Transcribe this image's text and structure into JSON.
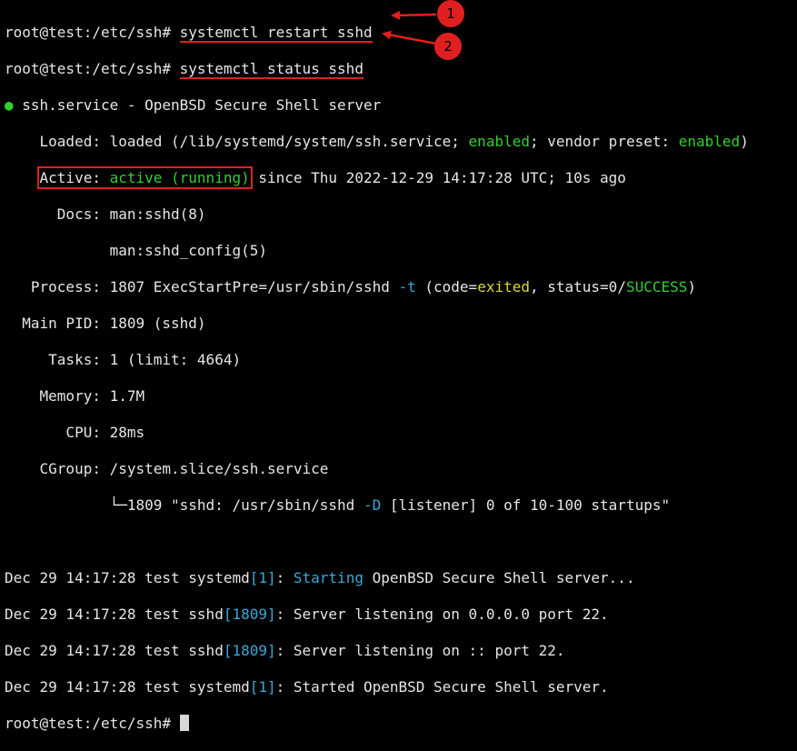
{
  "prompt": "root@test:/etc/ssh# ",
  "commands": [
    "systemctl restart sshd",
    "systemctl status sshd"
  ],
  "service": {
    "dot": "●",
    "header": " ssh.service - OpenBSD Secure Shell server",
    "loaded_label": "    Loaded: ",
    "loaded_a": "loaded (/lib/systemd/system/ssh.service; ",
    "loaded_enabled": "enabled",
    "loaded_b": "; vendor preset: ",
    "loaded_enabled2": "enabled",
    "loaded_c": ")",
    "active_indent": "    ",
    "active_label": "Active: ",
    "active_value": "active (running)",
    "active_rest": " since Thu 2022-12-29 14:17:28 UTC; 10s ago",
    "docs_1": "      Docs: man:sshd(8)",
    "docs_2": "            man:sshd_config(5)",
    "process_a": "   Process: 1807 ExecStartPre=/usr/sbin/sshd ",
    "process_flag": "-t",
    "process_b": " (code=",
    "process_exited": "exited",
    "process_c": ", status=0/",
    "process_success": "SUCCESS",
    "process_d": ")",
    "mainpid": "  Main PID: 1809 (sshd)",
    "tasks": "     Tasks: 1 (limit: 4664)",
    "memory": "    Memory: 1.7M",
    "cpu": "       CPU: 28ms",
    "cgroup": "    CGroup: /system.slice/ssh.service",
    "cgroup_child_a": "            └─1809 \"sshd: /usr/sbin/sshd ",
    "cgroup_child_flag": "-D",
    "cgroup_child_b": " [listener] 0 of 10-100 startups\""
  },
  "logs": [
    {
      "prefix": "Dec 29 14:17:28 test systemd",
      "pid": "[1]",
      "colon": ": ",
      "hl": "Starting",
      "rest": " OpenBSD Secure Shell server..."
    },
    {
      "prefix": "Dec 29 14:17:28 test sshd",
      "pid": "[1809]",
      "colon": ": ",
      "hl": "",
      "rest": "Server listening on 0.0.0.0 port 22."
    },
    {
      "prefix": "Dec 29 14:17:28 test sshd",
      "pid": "[1809]",
      "colon": ": ",
      "hl": "",
      "rest": "Server listening on :: port 22."
    },
    {
      "prefix": "Dec 29 14:17:28 test systemd",
      "pid": "[1]",
      "colon": ": ",
      "hl": "",
      "rest": "Started OpenBSD Secure Shell server."
    }
  ],
  "annotations": [
    "1",
    "2"
  ],
  "colors": {
    "background": "#000000",
    "text": "#e6e6e6",
    "green": "#30d030",
    "cyan": "#3aa8d8",
    "yellow": "#d8d830",
    "annotation_red": "#e02020"
  }
}
